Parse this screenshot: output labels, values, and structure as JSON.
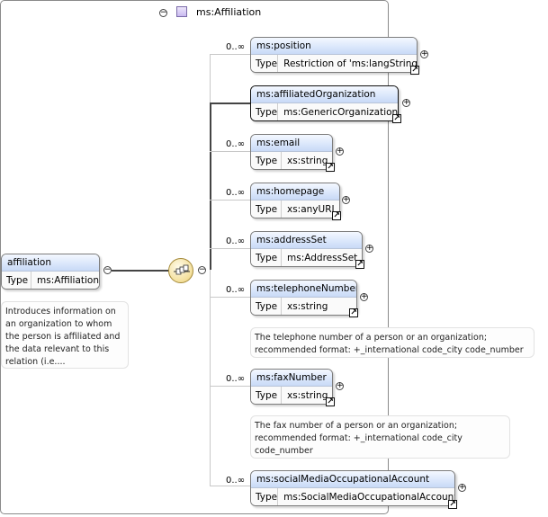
{
  "complex_type": {
    "title": "ms:Affiliation"
  },
  "root": {
    "name": "affiliation",
    "type_label": "Type",
    "type_value": "ms:Affiliation",
    "documentation": [
      "Introduces information on",
      "an organization to whom",
      "the person is affiliated and",
      "the data relevant to this",
      "relation (i.e...."
    ]
  },
  "children": [
    {
      "name": "ms:position",
      "type_label": "Type",
      "type_value": "Restriction of 'ms:langString'",
      "multiplicity": "0..∞"
    },
    {
      "name": "ms:affiliatedOrganization",
      "type_label": "Type",
      "type_value": "ms:GenericOrganization",
      "multiplicity": ""
    },
    {
      "name": "ms:email",
      "type_label": "Type",
      "type_value": "xs:string",
      "multiplicity": "0..∞"
    },
    {
      "name": "ms:homepage",
      "type_label": "Type",
      "type_value": "xs:anyURI",
      "multiplicity": "0..∞"
    },
    {
      "name": "ms:addressSet",
      "type_label": "Type",
      "type_value": "ms:AddressSet",
      "multiplicity": "0..∞"
    },
    {
      "name": "ms:telephoneNumber",
      "type_label": "Type",
      "type_value": "xs:string",
      "multiplicity": "0..∞",
      "documentation": [
        "The telephone number of a person or an organization;",
        "recommended format: +_international code_city code_number"
      ]
    },
    {
      "name": "ms:faxNumber",
      "type_label": "Type",
      "type_value": "xs:string",
      "multiplicity": "0..∞",
      "documentation": [
        "The fax number of a person or an organization;",
        "recommended format: +_international code_city",
        "code_number"
      ]
    },
    {
      "name": "ms:socialMediaOccupationalAccount",
      "type_label": "Type",
      "type_value": "ms:SocialMediaOccupationalAccount",
      "multiplicity": "0..∞"
    }
  ],
  "icons": {
    "collapse": "minus-circle-icon",
    "expand": "plus-circle-icon",
    "type_link": "type-link-arrow-icon",
    "sequence": "sequence-compositor-icon",
    "complex_type": "complex-type-icon"
  }
}
